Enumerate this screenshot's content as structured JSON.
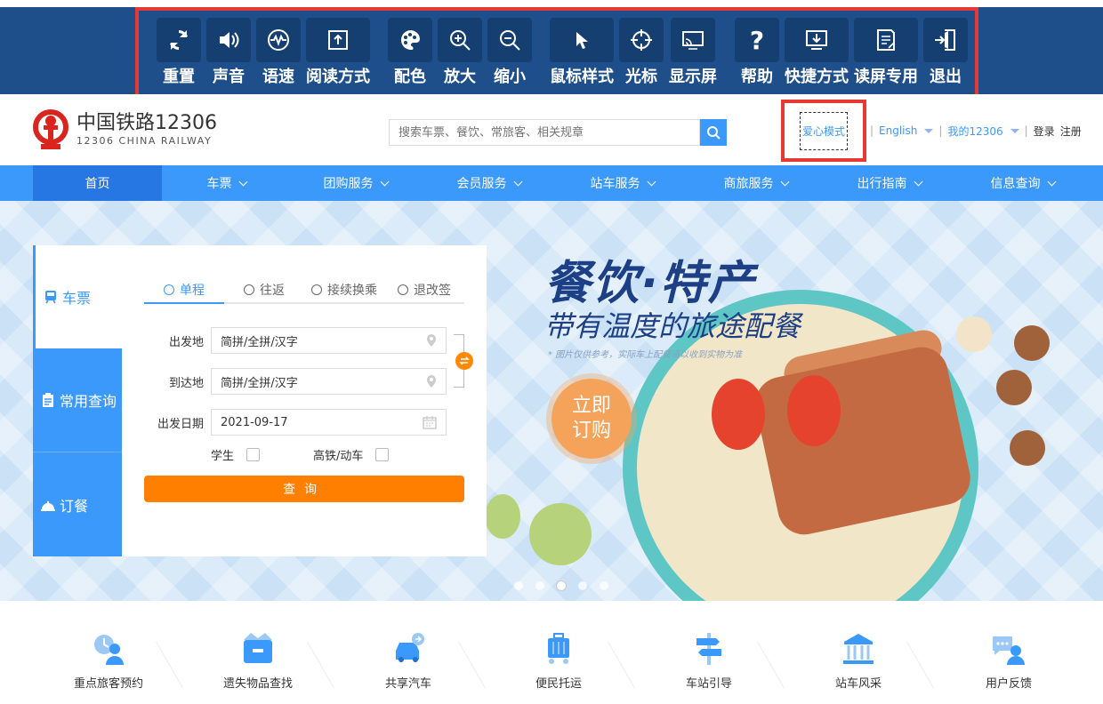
{
  "toolbar": {
    "items": [
      {
        "label": "重置",
        "icon": "reset-icon"
      },
      {
        "label": "声音",
        "icon": "sound-icon"
      },
      {
        "label": "语速",
        "icon": "speed-icon"
      },
      {
        "label": "阅读方式",
        "icon": "read-mode-icon"
      },
      {
        "label": "配色",
        "icon": "palette-icon"
      },
      {
        "label": "放大",
        "icon": "zoom-in-icon"
      },
      {
        "label": "缩小",
        "icon": "zoom-out-icon"
      },
      {
        "label": "鼠标样式",
        "icon": "cursor-icon"
      },
      {
        "label": "光标",
        "icon": "crosshair-icon"
      },
      {
        "label": "显示屏",
        "icon": "screen-icon"
      },
      {
        "label": "帮助",
        "icon": "help-icon"
      },
      {
        "label": "快捷方式",
        "icon": "shortcut-icon"
      },
      {
        "label": "读屏专用",
        "icon": "screen-reader-icon"
      },
      {
        "label": "退出",
        "icon": "exit-icon"
      }
    ]
  },
  "header": {
    "logo_cn": "中国铁路12306",
    "logo_en": "12306 CHINA RAILWAY",
    "search_placeholder": "搜索车票、餐饮、常旅客、相关规章",
    "care_mode": "爱心模式",
    "english": "English",
    "my12306": "我的12306",
    "login": "登录",
    "register": "注册"
  },
  "nav": {
    "items": [
      "首页",
      "车票",
      "团购服务",
      "会员服务",
      "站车服务",
      "商旅服务",
      "出行指南",
      "信息查询"
    ]
  },
  "banner": {
    "title": "餐饮·特产",
    "subtitle": "带有温度的旅途配餐",
    "note": "* 图片仅供参考，实际车上配餐请以收到实物为准",
    "order_line1": "立即",
    "order_line2": "订购"
  },
  "booking": {
    "side_tabs": [
      "车票",
      "常用查询",
      "订餐"
    ],
    "trip_tabs": [
      "单程",
      "往返",
      "接续换乘",
      "退改签"
    ],
    "from_label": "出发地",
    "from_value": "简拼/全拼/汉字",
    "to_label": "到达地",
    "to_value": "简拼/全拼/汉字",
    "date_label": "出发日期",
    "date_value": "2021-09-17",
    "student_label": "学生",
    "highspeed_label": "高铁/动车",
    "query_label": "查询"
  },
  "services": {
    "items": [
      "重点旅客预约",
      "遗失物品查找",
      "共享汽车",
      "便民托运",
      "车站引导",
      "站车风采",
      "用户反馈"
    ]
  },
  "colors": {
    "toolbar_bg": "#1e4f8a",
    "accent": "#3b99fc",
    "highlight": "#e53935",
    "query": "#ff8000"
  }
}
